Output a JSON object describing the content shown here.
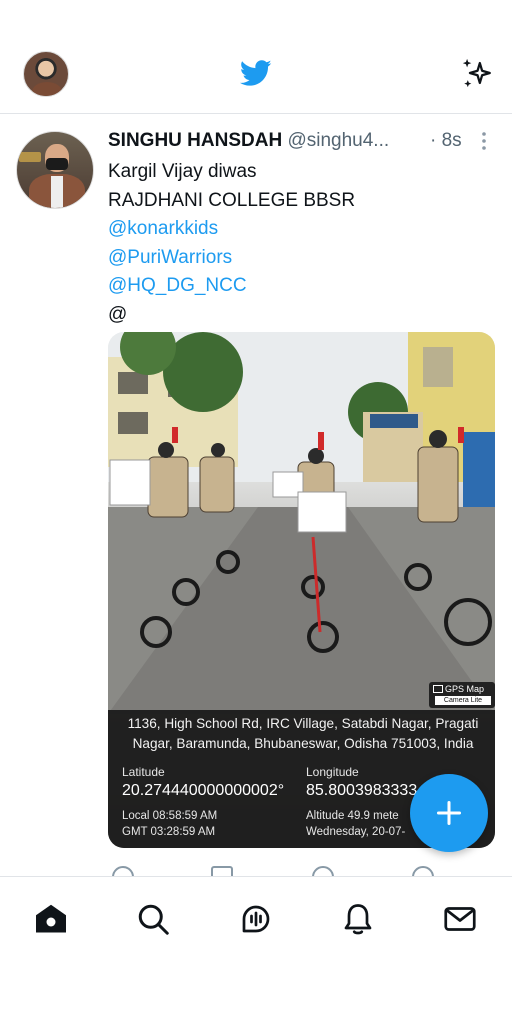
{
  "header": {
    "brand_icon": "twitter-bird-icon",
    "right_icon": "sparkle-icon",
    "accent_color": "#1d9bf0"
  },
  "tweet": {
    "display_name": "SINGHU HANSDAH",
    "handle": "@singhu4...",
    "time": "· 8s",
    "lines": [
      "Kargil Vijay diwas",
      "RAJDHANI COLLEGE BBSR",
      "@konarkkids",
      "@PuriWarriors",
      "@HQ_DG_NCC",
      "@"
    ],
    "photo": {
      "badge_title": "GPS Map",
      "badge_sub": "Camera Lite",
      "address": "1136, High School Rd, IRC Village, Satabdi Nagar, Pragati Nagar, Baramunda, Bhubaneswar, Odisha 751003, India",
      "latitude_label": "Latitude",
      "latitude": "20.274440000000002°",
      "longitude_label": "Longitude",
      "longitude": "85.8003983333",
      "local_time": "Local 08:58:59 AM",
      "gmt_time": "GMT 03:28:59 AM",
      "altitude": "Altitude 49.9 mete",
      "date": "Wednesday, 20-07-"
    }
  },
  "fab": {
    "icon": "plus-icon"
  },
  "bottom_nav": [
    {
      "name": "home",
      "icon": "home-icon"
    },
    {
      "name": "search",
      "icon": "search-icon"
    },
    {
      "name": "spaces",
      "icon": "spaces-icon"
    },
    {
      "name": "notifications",
      "icon": "bell-icon"
    },
    {
      "name": "messages",
      "icon": "mail-icon"
    }
  ]
}
